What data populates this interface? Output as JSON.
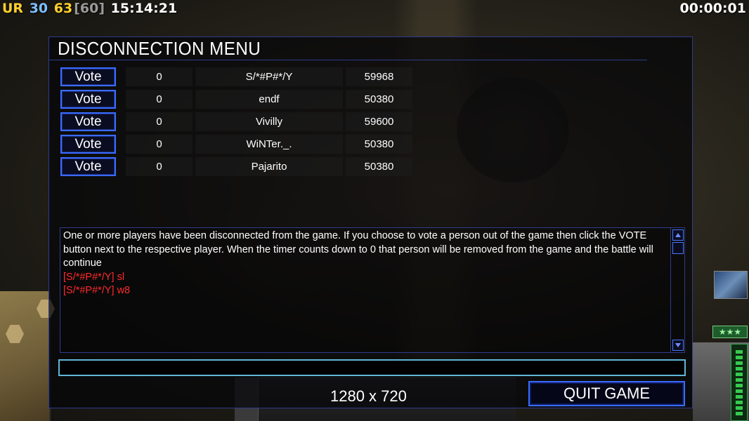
{
  "hud": {
    "faction": "UR",
    "stat_a": "30",
    "stat_b": "63",
    "stat_c": "[60]",
    "clock": "15:14:21",
    "timer": "00:00:01",
    "colors": {
      "faction": "#ffd02e",
      "stat_a": "#7ec0ff",
      "stat_b": "#ffd02e",
      "stat_c": "#9a9a9a"
    }
  },
  "panel": {
    "title": "DISCONNECTION MENU",
    "players": [
      {
        "vote_label": "Vote",
        "count": "0",
        "name": "S/*#P#*/Y",
        "ping": "59968"
      },
      {
        "vote_label": "Vote",
        "count": "0",
        "name": "endf",
        "ping": "50380"
      },
      {
        "vote_label": "Vote",
        "count": "0",
        "name": "Vivilly",
        "ping": "59600"
      },
      {
        "vote_label": "Vote",
        "count": "0",
        "name": "WiNTer._.",
        "ping": "50380"
      },
      {
        "vote_label": "Vote",
        "count": "0",
        "name": "Pajarito",
        "ping": "50380"
      }
    ],
    "chat": {
      "info": "One or more players have been disconnected from the game. If you choose to vote a person out of the game then click the VOTE button next to the respective player. When the timer counts down to 0 that person will be removed from the game and the battle will continue",
      "messages": [
        "[S/*#P#*/Y] sl",
        "[S/*#P#*/Y] w8"
      ],
      "message_color": "#ff2a2a"
    },
    "chat_input": {
      "value": ""
    },
    "quit_label": "QUIT GAME"
  },
  "overlay": {
    "resolution": "1280 x 720"
  },
  "icons": {
    "scroll_up": "triangle-up-icon",
    "scroll_down": "triangle-down-icon",
    "satellite": "satellite-icon",
    "rank": "stars-icon"
  },
  "rank_badge": "★★★"
}
